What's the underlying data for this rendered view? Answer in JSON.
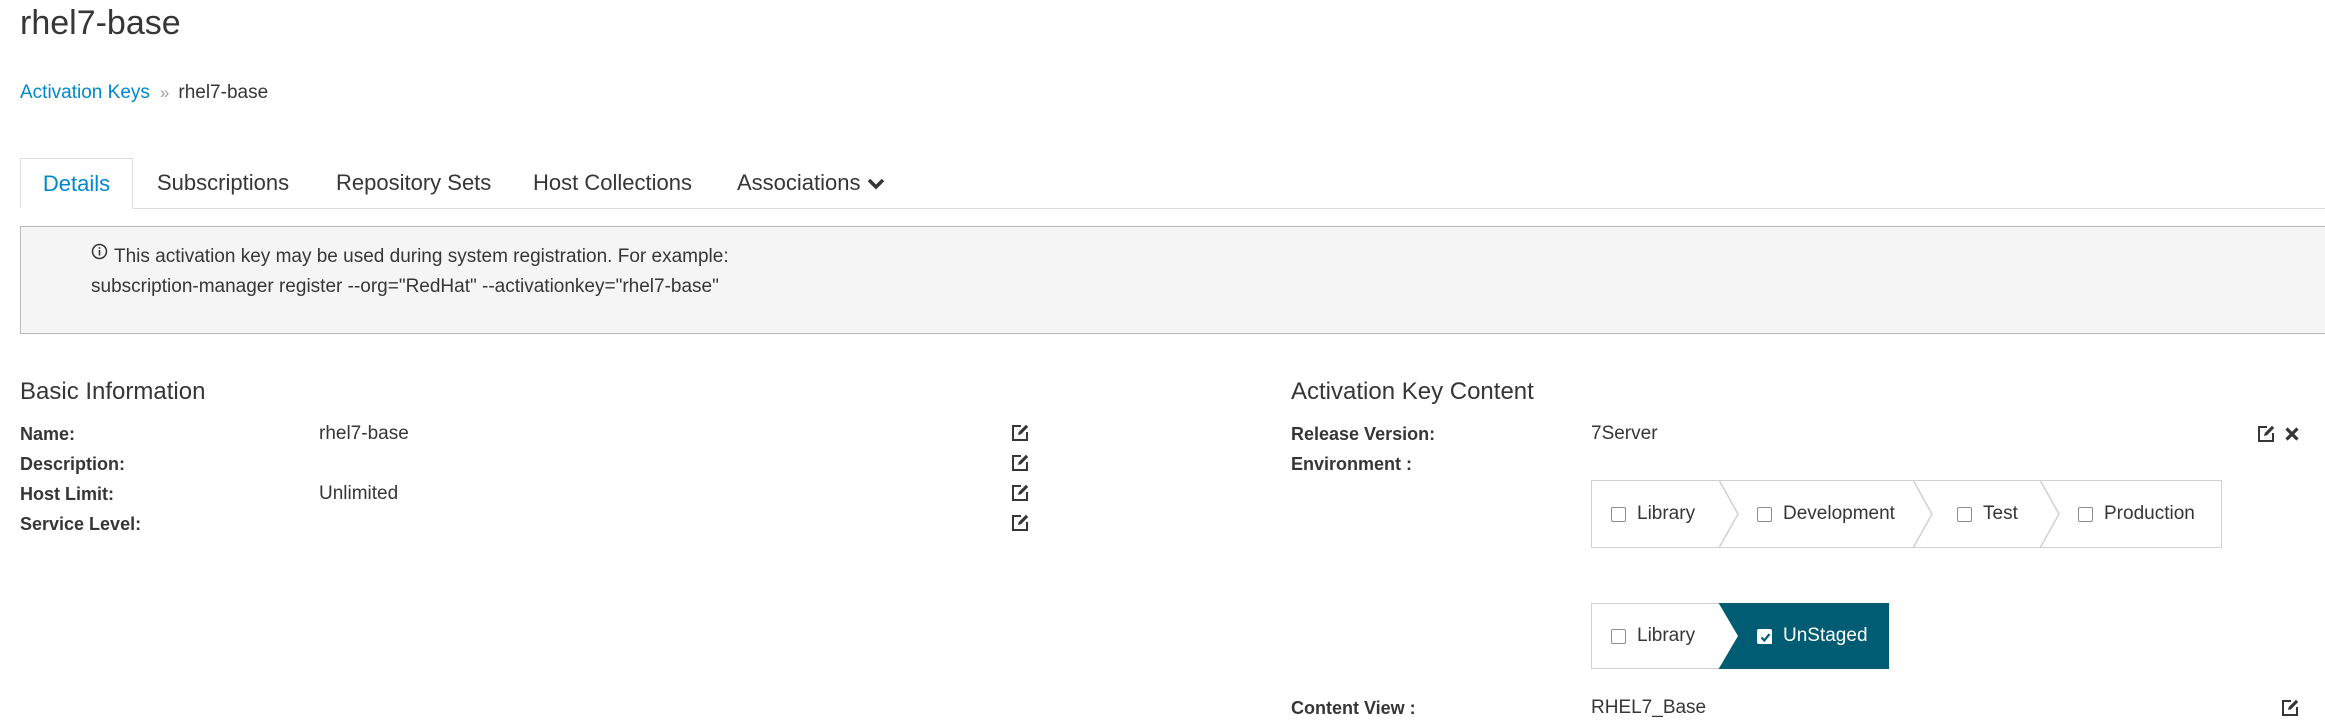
{
  "page": {
    "title": "rhel7-base"
  },
  "breadcrumb": {
    "parent": "Activation Keys",
    "separator": "»",
    "current": "rhel7-base"
  },
  "tabs": [
    {
      "label": "Details",
      "active": true
    },
    {
      "label": "Subscriptions"
    },
    {
      "label": "Repository Sets"
    },
    {
      "label": "Host Collections"
    },
    {
      "label": "Associations",
      "icon": "chevron-down-icon"
    }
  ],
  "info": {
    "icon": "info-circle-icon",
    "line1": "This activation key may be used during system registration. For example:",
    "line2": "subscription-manager register --org=\"RedHat\" --activationkey=\"rhel7-base\""
  },
  "basic_info": {
    "title": "Basic Information",
    "rows": [
      {
        "label": "Name:",
        "value": "rhel7-base"
      },
      {
        "label": "Description:",
        "value": ""
      },
      {
        "label": "Host Limit:",
        "value": "Unlimited"
      },
      {
        "label": "Service Level:",
        "value": ""
      }
    ]
  },
  "content": {
    "title": "Activation Key Content",
    "release_label": "Release Version:",
    "release_value": "7Server",
    "environment_label": "Environment :",
    "path1": [
      {
        "label": "Library",
        "checked": false
      },
      {
        "label": "Development",
        "checked": false
      },
      {
        "label": "Test",
        "checked": false
      },
      {
        "label": "Production",
        "checked": false
      }
    ],
    "path2": [
      {
        "label": "Library",
        "checked": false
      },
      {
        "label": "UnStaged",
        "checked": true
      }
    ],
    "content_view_label": "Content View :",
    "content_view_value": "RHEL7_Base"
  },
  "colors": {
    "accent": "#0088ce",
    "selected_env": "#005c73",
    "edit_icon": "#363636"
  }
}
